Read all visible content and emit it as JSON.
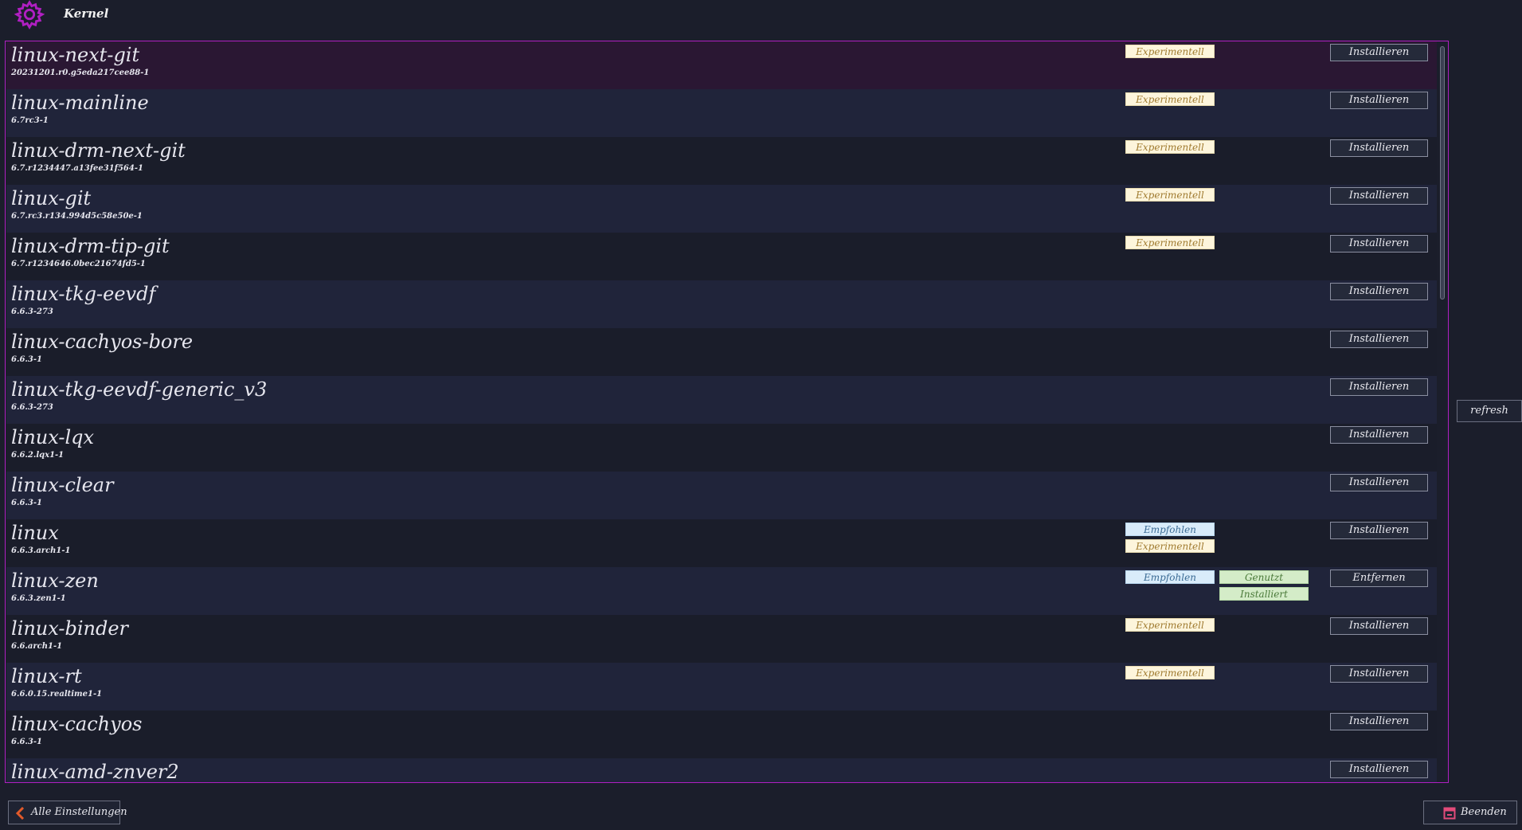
{
  "header": {
    "title": "Kernel",
    "icon": "gear-icon",
    "accent": "#b01fc2"
  },
  "badges": {
    "experimental": "Experimentell",
    "recommended": "Empfohlen",
    "used": "Genutzt",
    "installed": "Installiert"
  },
  "kernels": [
    {
      "name": "linux-next-git",
      "version": "20231201.r0.g5eda217cee88-1",
      "action": "Installieren",
      "selected": true
    },
    {
      "name": "linux-mainline",
      "version": "6.7rc3-1",
      "action": "Installieren"
    },
    {
      "name": "linux-drm-next-git",
      "version": "6.7.r1234447.a13fee31f564-1",
      "action": "Installieren"
    },
    {
      "name": "linux-git",
      "version": "6.7.rc3.r134.994d5c58e50e-1",
      "action": "Installieren"
    },
    {
      "name": "linux-drm-tip-git",
      "version": "6.7.r1234646.0bec21674fd5-1",
      "action": "Installieren"
    },
    {
      "name": "linux-tkg-eevdf",
      "version": "6.6.3-273",
      "action": "Installieren"
    },
    {
      "name": "linux-cachyos-bore",
      "version": "6.6.3-1",
      "action": "Installieren"
    },
    {
      "name": "linux-tkg-eevdf-generic_v3",
      "version": "6.6.3-273",
      "action": "Installieren"
    },
    {
      "name": "linux-lqx",
      "version": "6.6.2.lqx1-1",
      "action": "Installieren"
    },
    {
      "name": "linux-clear",
      "version": "6.6.3-1",
      "action": "Installieren"
    },
    {
      "name": "linux",
      "version": "6.6.3.arch1-1",
      "action": "Installieren"
    },
    {
      "name": "linux-zen",
      "version": "6.6.3.zen1-1",
      "action": "Entfernen"
    },
    {
      "name": "linux-binder",
      "version": "6.6.arch1-1",
      "action": "Installieren"
    },
    {
      "name": "linux-rt",
      "version": "6.6.0.15.realtime1-1",
      "action": "Installieren"
    },
    {
      "name": "linux-cachyos",
      "version": "6.6.3-1",
      "action": "Installieren"
    },
    {
      "name": "linux-amd-znver2",
      "version": "",
      "action": "Installieren"
    }
  ],
  "sidebar": {
    "refresh_label": "refresh"
  },
  "footer": {
    "back_label": "Alle Einstellungen",
    "back_icon": "chevron-left-icon",
    "quit_label": "Beenden",
    "quit_icon": "quit-icon"
  }
}
